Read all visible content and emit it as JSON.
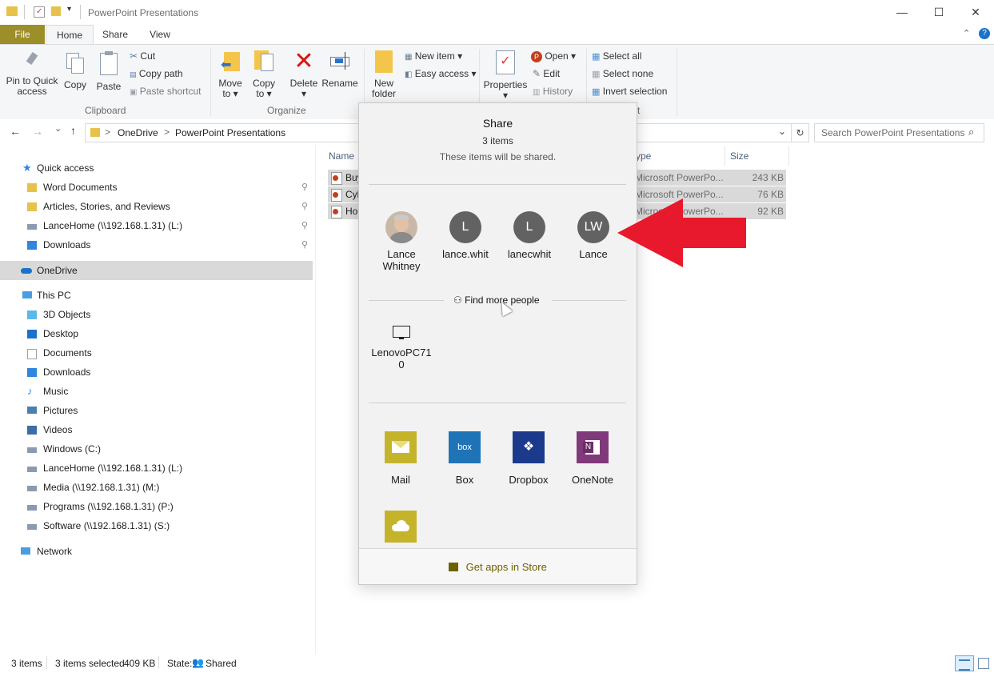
{
  "window": {
    "title": "PowerPoint Presentations",
    "minimize": "—",
    "maximize": "☐",
    "close": "✕"
  },
  "ribbon_tabs": [
    "File",
    "Home",
    "Share",
    "View"
  ],
  "ribbon": {
    "clipboard": {
      "pin": "Pin to Quick access",
      "pin_l1": "Pin to Quick",
      "pin_l2": "access",
      "copy": "Copy",
      "paste": "Paste",
      "cut": "Cut",
      "copy_path": "Copy path",
      "paste_shortcut": "Paste shortcut",
      "group": "Clipboard"
    },
    "organize": {
      "move_l1": "Move",
      "move_l2": "to ▾",
      "copy_l1": "Copy",
      "copy_l2": "to ▾",
      "delete_l1": "Delete",
      "delete_l2": "▾",
      "rename": "Rename",
      "group": "Organize"
    },
    "new": {
      "folder_l1": "New",
      "folder_l2": "folder",
      "new_item": "New item ▾",
      "easy_access": "Easy access ▾"
    },
    "open": {
      "properties": "Properties",
      "properties_arrow": "▾",
      "open": "Open ▾",
      "edit": "Edit",
      "history": "History"
    },
    "select": {
      "select_all": "Select all",
      "select_none": "Select none",
      "invert": "Invert selection",
      "group_partial": "ct"
    }
  },
  "address": {
    "back": "←",
    "forward": "→",
    "recent": "⌄",
    "up": "↑",
    "crumbs": [
      "OneDrive",
      "PowerPoint Presentations"
    ],
    "sep": ">",
    "dropdown": "⌄",
    "refresh": "↻",
    "search_placeholder": "Search PowerPoint Presentations"
  },
  "nav": {
    "quick_access": "Quick access",
    "qa_items": [
      {
        "label": "Word Documents",
        "pinned": true
      },
      {
        "label": "Articles, Stories, and Reviews",
        "pinned": true
      },
      {
        "label": "LanceHome (\\\\192.168.1.31) (L:)",
        "pinned": true
      },
      {
        "label": "Downloads",
        "pinned": true
      }
    ],
    "onedrive": "OneDrive",
    "this_pc": "This PC",
    "pc_items": [
      "3D Objects",
      "Desktop",
      "Documents",
      "Downloads",
      "Music",
      "Pictures",
      "Videos",
      "Windows (C:)",
      "LanceHome (\\\\192.168.1.31) (L:)",
      "Media (\\\\192.168.1.31) (M:)",
      "Programs (\\\\192.168.1.31) (P:)",
      "Software (\\\\192.168.1.31) (S:)"
    ],
    "network": "Network",
    "pin_glyph": "📌"
  },
  "file_list": {
    "col_name": "Name",
    "col_type": "ype",
    "col_size": "Size",
    "rows": [
      {
        "name": "Buy",
        "type": "Microsoft PowerPo...",
        "size": "243 KB"
      },
      {
        "name": "Cyb",
        "type": "Microsoft PowerPo...",
        "size": "76 KB"
      },
      {
        "name": "Ho",
        "type": "Microsoft PowerPo...",
        "size": "92 KB"
      }
    ]
  },
  "status": {
    "count": "3 items",
    "selected": "3 items selected",
    "size": "409 KB",
    "state_label": "State:",
    "state_value": "Shared"
  },
  "share": {
    "title": "Share",
    "count": "3 items",
    "subtitle": "These items will be shared.",
    "people": [
      {
        "initials": "",
        "line1": "Lance",
        "line2": "Whitney",
        "photo": true
      },
      {
        "initials": "L",
        "line1": "lance.whit",
        "line2": ""
      },
      {
        "initials": "L",
        "line1": "lanecwhit",
        "line2": ""
      },
      {
        "initials": "LW",
        "line1": "Lance",
        "line2": ""
      }
    ],
    "find_more": "Find more people",
    "device": {
      "line1": "LenovoPC71",
      "line2": "0"
    },
    "apps": [
      {
        "label": "Mail",
        "color": "#c5b42b"
      },
      {
        "label": "Box",
        "color": "#1f73b7",
        "text": "box"
      },
      {
        "label": "Dropbox",
        "color": "#1c3a8c"
      },
      {
        "label": "OneNote",
        "color": "#80397b"
      }
    ],
    "onedrive_color": "#c5b42b",
    "store": "Get apps in Store"
  },
  "colors": {
    "accent_file_tab": "#9c8e29",
    "arrow": "#e8192c",
    "selection": "#d9d9d9"
  }
}
